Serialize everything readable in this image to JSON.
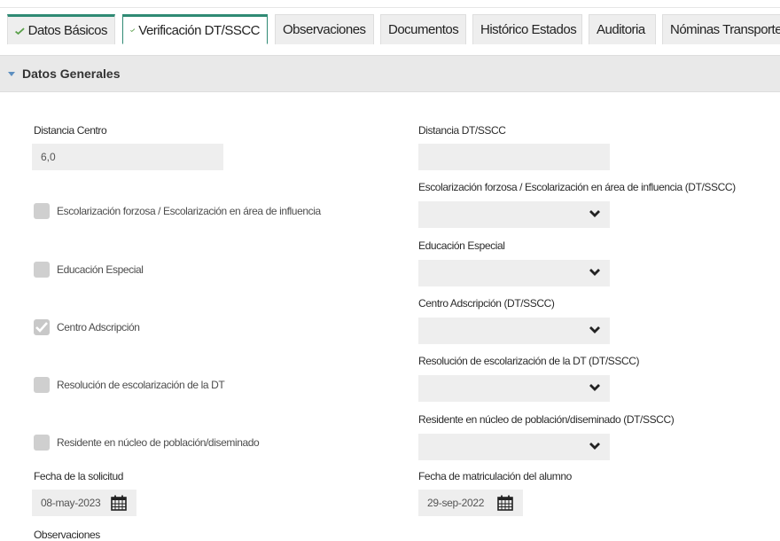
{
  "tabs": [
    {
      "label": "Datos Básicos",
      "checked": true
    },
    {
      "label": "Verificación DT/SSCC",
      "checked": true,
      "active": true
    },
    {
      "label": "Observaciones"
    },
    {
      "label": "Documentos"
    },
    {
      "label": "Histórico Estados"
    },
    {
      "label": "Auditoria"
    },
    {
      "label": "Nóminas Transporte"
    }
  ],
  "section": {
    "title": "Datos Generales"
  },
  "form": {
    "distancia_centro": {
      "label": "Distancia Centro",
      "value": "6,0"
    },
    "distancia_dt": {
      "label": "Distancia DT/SSCC",
      "value": ""
    },
    "checkboxes": [
      {
        "label": "Escolarización forzosa / Escolarización en área de influencia",
        "checked": false
      },
      {
        "label": "Educación Especial",
        "checked": false
      },
      {
        "label": "Centro Adscripción",
        "checked": true
      },
      {
        "label": "Resolución de escolarización de la DT",
        "checked": false
      },
      {
        "label": "Residente en núcleo de población/diseminado",
        "checked": false
      }
    ],
    "selects": [
      {
        "label": "Escolarización forzosa / Escolarización en área de influencia (DT/SSCC)",
        "value": ""
      },
      {
        "label": "Educación Especial",
        "value": ""
      },
      {
        "label": "Centro Adscripción (DT/SSCC)",
        "value": ""
      },
      {
        "label": "Resolución de escolarización de la DT (DT/SSCC)",
        "value": ""
      },
      {
        "label": "Residente en núcleo de población/diseminado (DT/SSCC)",
        "value": ""
      }
    ],
    "fecha_solicitud": {
      "label": "Fecha de la solicitud",
      "value": "08-may-2023"
    },
    "fecha_matriculacion": {
      "label": "Fecha de matriculación del alumno",
      "value": "29-sep-2022"
    },
    "observaciones": {
      "label": "Observaciones"
    }
  },
  "colors": {
    "accent": "#2f8a74",
    "check_green": "#5aa04a",
    "field_bg": "#eeeeee",
    "section_bg": "#e9e9e9"
  }
}
